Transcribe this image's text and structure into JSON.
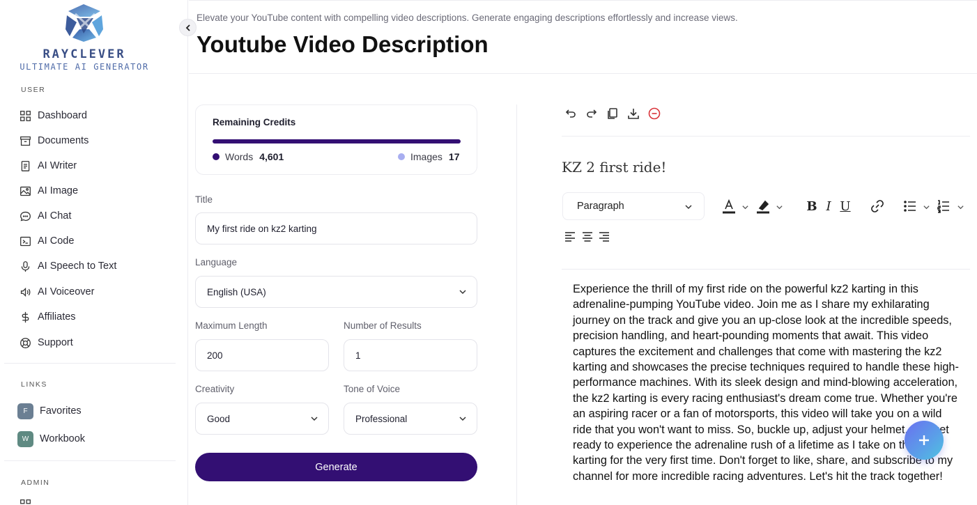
{
  "brand": {
    "name": "RAYCLEVER",
    "tagline": "ULTIMATE AI GENERATOR",
    "colors": {
      "primary": "#330f73",
      "accent": "#a8aef0"
    }
  },
  "sidebar": {
    "user_label": "USER",
    "items": [
      {
        "label": "Dashboard",
        "icon": "grid-icon"
      },
      {
        "label": "Documents",
        "icon": "archive-icon"
      },
      {
        "label": "AI Writer",
        "icon": "document-icon"
      },
      {
        "label": "AI Image",
        "icon": "image-icon"
      },
      {
        "label": "AI Chat",
        "icon": "chat-icon"
      },
      {
        "label": "AI Code",
        "icon": "terminal-icon"
      },
      {
        "label": "AI Speech to Text",
        "icon": "microphone-icon"
      },
      {
        "label": "AI Voiceover",
        "icon": "speaker-icon"
      },
      {
        "label": "Affiliates",
        "icon": "dollar-icon"
      },
      {
        "label": "Support",
        "icon": "lifebuoy-icon"
      }
    ],
    "links_label": "LINKS",
    "links": [
      {
        "badge": "F",
        "label": "Favorites"
      },
      {
        "badge": "W",
        "label": "Workbook"
      }
    ],
    "admin_label": "ADMIN"
  },
  "header": {
    "subtitle": "Elevate your YouTube content with compelling video descriptions. Generate engaging descriptions effortlessly and increase views.",
    "title": "Youtube Video Description"
  },
  "credits": {
    "title": "Remaining Credits",
    "words_label": "Words",
    "words_value": "4,601",
    "images_label": "Images",
    "images_value": "17"
  },
  "form": {
    "title_label": "Title",
    "title_value": "My first ride on kz2 karting",
    "language_label": "Language",
    "language_value": "English (USA)",
    "max_length_label": "Maximum Length",
    "max_length_value": "200",
    "results_label": "Number of Results",
    "results_value": "1",
    "creativity_label": "Creativity",
    "creativity_value": "Good",
    "tone_label": "Tone of Voice",
    "tone_value": "Professional",
    "generate_label": "Generate"
  },
  "editor": {
    "doc_title": "KZ 2 first ride!",
    "block_format": "Paragraph",
    "body": "Experience the thrill of my first ride on the powerful kz2 karting in this adrenaline-pumping YouTube video. Join me as I share my exhilarating journey on the track and give you an up-close look at the incredible speeds, precision handling, and heart-pounding moments that await. This video captures the excitement and challenges that come with mastering the kz2 karting and showcases the precise techniques required to handle these high-performance machines. With its sleek design and mind-blowing acceleration, the kz2 karting is every racing enthusiast's dream come true. Whether you're an aspiring racer or a fan of motorsports, this video will take you on a wild ride that you won't want to miss. So, buckle up, adjust your helmet, and get ready to experience the adrenaline rush of a lifetime as I take on the kz2 karting for the very first time. Don't forget to like, share, and subscribe to my channel for more incredible racing adventures. Let's hit the track together!"
  }
}
